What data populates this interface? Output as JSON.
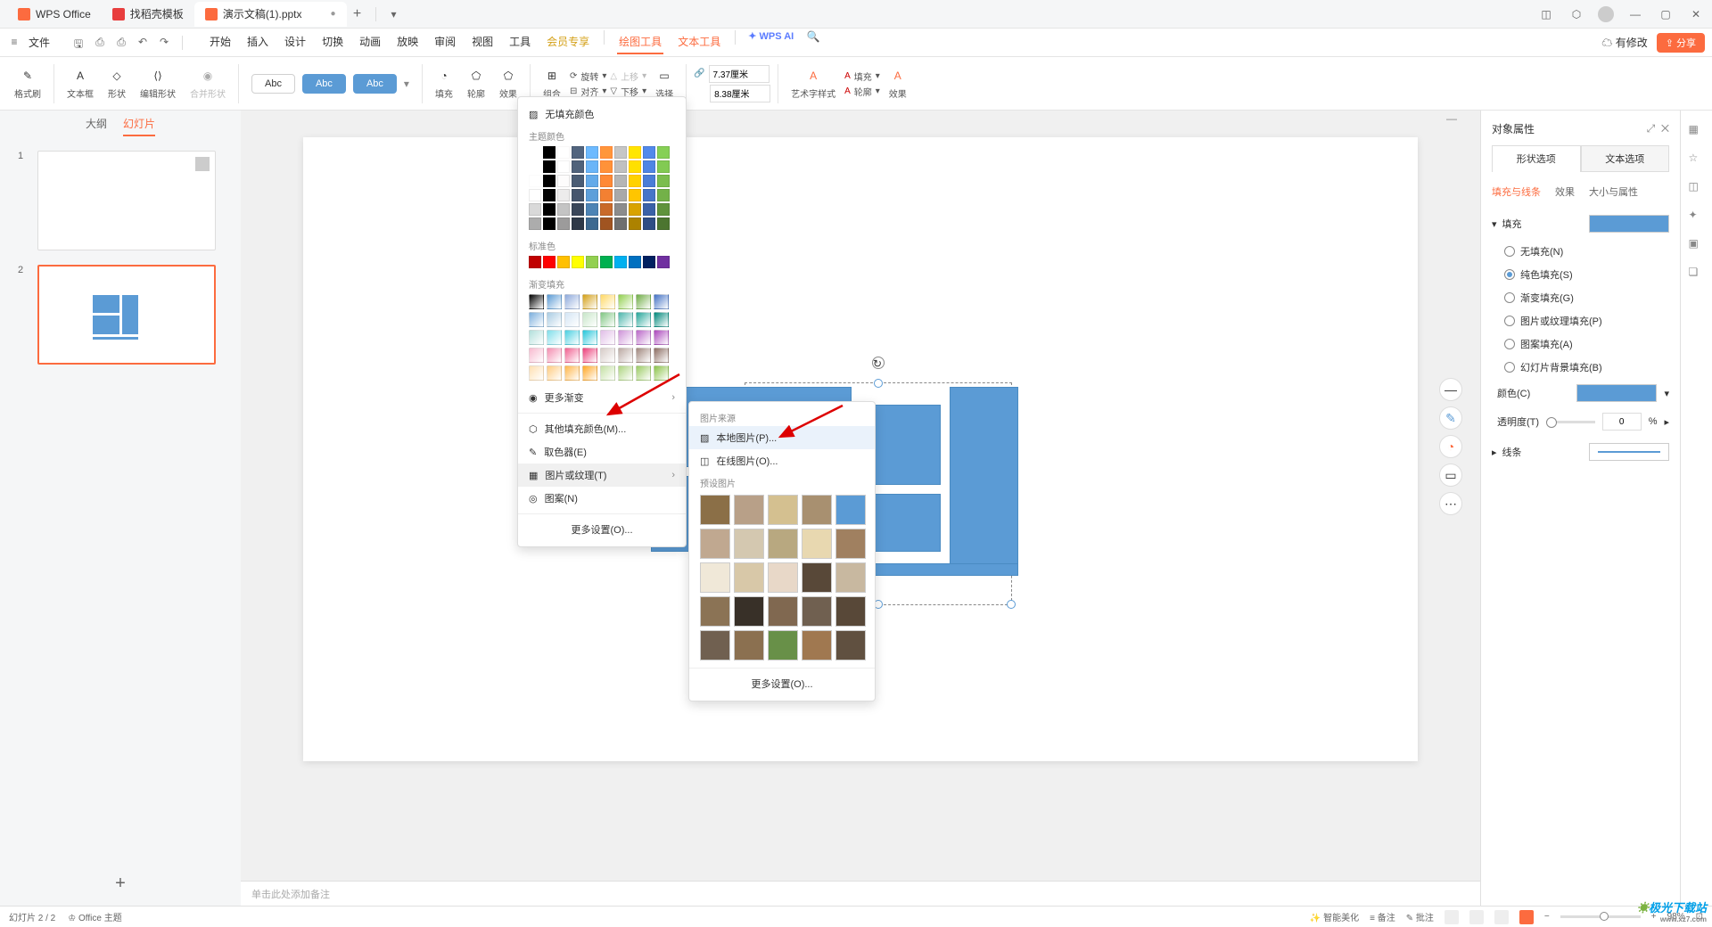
{
  "tabs": {
    "wps": "WPS Office",
    "docer": "找稻壳模板",
    "current": "演示文稿(1).pptx"
  },
  "file_menu": "文件",
  "menu": {
    "start": "开始",
    "insert": "插入",
    "design": "设计",
    "transition": "切换",
    "animation": "动画",
    "slideshow": "放映",
    "review": "审阅",
    "view": "视图",
    "tools": "工具",
    "member": "会员专享",
    "draw": "绘图工具",
    "text": "文本工具",
    "ai": "WPS AI",
    "pending": "有修改",
    "share": "分享"
  },
  "ribbon": {
    "format_painter": "格式刷",
    "textbox": "文本框",
    "shape": "形状",
    "edit_shape": "编辑形状",
    "merge_shape": "合并形状",
    "abc": "Abc",
    "fill": "填充",
    "outline": "轮廓",
    "effect": "效果",
    "group": "组合",
    "rotate": "旋转",
    "align": "对齐",
    "move_up": "上移",
    "move_down": "下移",
    "select": "选择",
    "width": "7.37厘米",
    "height": "8.38厘米",
    "art_style": "艺术字样式",
    "fill2": "填充",
    "outline2": "轮廓",
    "effect2": "效果"
  },
  "slide_panel": {
    "outline": "大纲",
    "slides": "幻灯片"
  },
  "fill_dd": {
    "no_fill": "无填充颜色",
    "theme": "主题颜色",
    "standard": "标准色",
    "gradient": "渐变填充",
    "more_gradient": "更多渐变",
    "other_fill": "其他填充颜色(M)...",
    "eyedropper": "取色器(E)",
    "picture_texture": "图片或纹理(T)",
    "pattern": "图案(N)",
    "more_settings": "更多设置(O)..."
  },
  "texture": {
    "source": "图片来源",
    "local": "本地图片(P)...",
    "online": "在线图片(O)...",
    "preset": "预设图片",
    "more": "更多设置(O)..."
  },
  "panel": {
    "title": "对象属性",
    "shape_opt": "形状选项",
    "text_opt": "文本选项",
    "fill_line": "填充与线条",
    "effect": "效果",
    "size_prop": "大小与属性",
    "fill": "填充",
    "no_fill": "无填充(N)",
    "solid": "纯色填充(S)",
    "gradient": "渐变填充(G)",
    "pic_tex": "图片或纹理填充(P)",
    "pattern": "图案填充(A)",
    "slide_bg": "幻灯片背景填充(B)",
    "color": "颜色(C)",
    "transparency": "透明度(T)",
    "transparency_val": "0",
    "percent": "%",
    "line": "线条"
  },
  "notes": "单击此处添加备注",
  "status": {
    "slide": "幻灯片 2 / 2",
    "theme": "Office 主题",
    "beautify": "智能美化",
    "notes": "备注",
    "comment": "批注",
    "zoom": "98%"
  },
  "watermark": {
    "brand": "极光下载站",
    "url": "www.xz7.com"
  },
  "theme_colors": [
    "#ffffff",
    "#000000",
    "#e7e6e6",
    "#44546a",
    "#5b9bd5",
    "#ed7d31",
    "#a5a5a5",
    "#ffc000",
    "#4472c4",
    "#70ad47"
  ],
  "standard_colors": [
    "#c00000",
    "#ff0000",
    "#ffc000",
    "#ffff00",
    "#92d050",
    "#00b050",
    "#00b0f0",
    "#0070c0",
    "#002060",
    "#7030a0"
  ],
  "texture_colors": [
    "#8b6f47",
    "#b8a088",
    "#d4c090",
    "#a89070",
    "#5b9bd5",
    "#c0a890",
    "#d4c8b0",
    "#b8a880",
    "#e8d8b0",
    "#a08060",
    "#f0e8d8",
    "#d8c8a8",
    "#e8d8c8",
    "#584838",
    "#c8b8a0",
    "#8b7355",
    "#383028",
    "#806850",
    "#706050",
    "#584838",
    "#706050",
    "#8b7050",
    "#689048",
    "#a07850",
    "#605040"
  ]
}
